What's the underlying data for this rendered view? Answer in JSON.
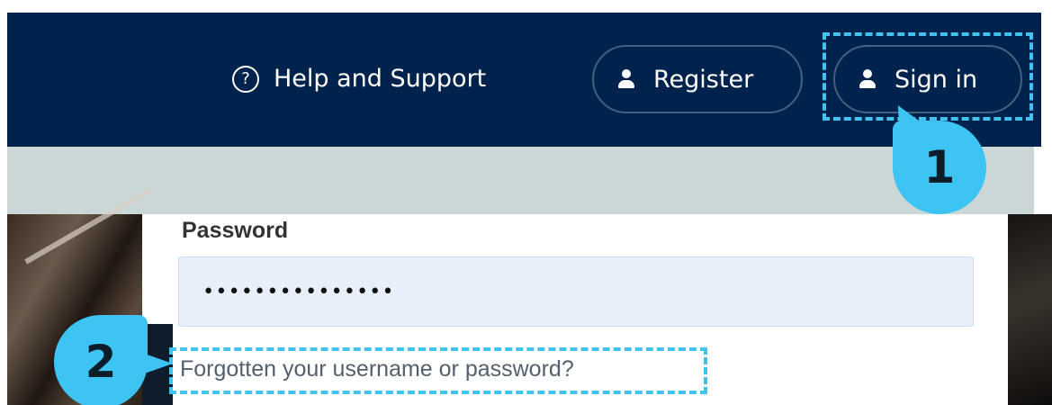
{
  "header": {
    "help_label": "Help and Support",
    "help_icon": "question-circle-icon",
    "register_label": "Register",
    "signin_label": "Sign in",
    "user_icon": "user-icon",
    "background_color": "#00234d"
  },
  "callouts": {
    "step1": "1",
    "step2": "2",
    "accent_color": "#3ec4f2"
  },
  "form": {
    "password_label": "Password",
    "password_value": "•••••••••••••••",
    "forgot_link": "Forgotten your username or password?"
  }
}
